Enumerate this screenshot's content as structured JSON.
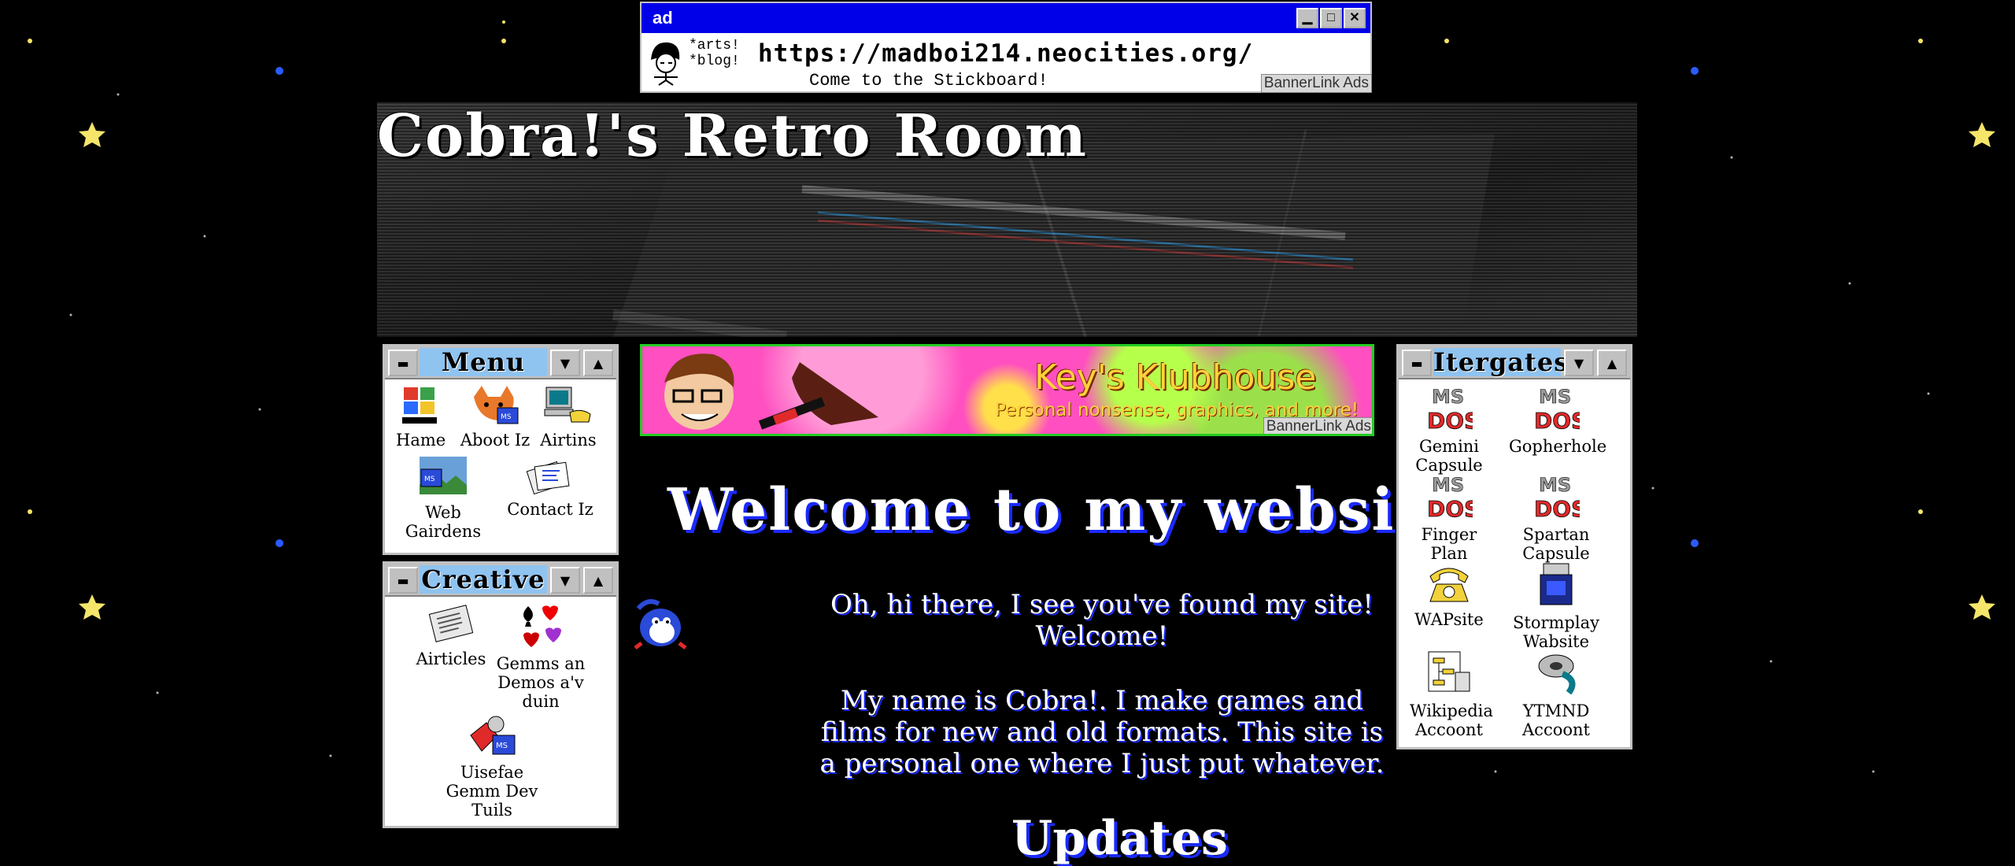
{
  "ad": {
    "title": "ad",
    "tagline": "*arts!\n*blog!",
    "url": "https://madboi214.neocities.org/",
    "subtext": "Come to the Stickboard!",
    "bannerlink": "BannerLink Ads"
  },
  "header": {
    "title": "Cobra!'s Retro Room"
  },
  "menu_panel": {
    "title": "Menu",
    "items": [
      {
        "label": "Hame",
        "icon": "windows-logo-icon"
      },
      {
        "label": "Aboot Iz",
        "icon": "fox-msdos-icon"
      },
      {
        "label": "Airtins",
        "icon": "computer-phone-icon"
      },
      {
        "label": "Web Gairdens",
        "icon": "msdos-landscape-icon"
      },
      {
        "label": "Contact Iz",
        "icon": "cards-icon"
      }
    ]
  },
  "creative_panel": {
    "title": "Creative",
    "items": [
      {
        "label": "Airticles",
        "icon": "newspaper-icon"
      },
      {
        "label": "Gemms an Demos a'v duin",
        "icon": "card-suits-icon"
      },
      {
        "label": "Uisefae Gemm Dev Tuils",
        "icon": "msdos-tools-icon"
      }
    ]
  },
  "klubhouse": {
    "title": "Key's Klubhouse",
    "subtitle": "Personal nonsense, graphics, and more!",
    "bannerlink": "BannerLink Ads"
  },
  "main": {
    "welcome": "Welcome to my website!",
    "intro_line1": "Oh, hi there, I see you've found my site!",
    "intro_line2": "Welcome!",
    "about_line1": "My name is Cobra!. I make games and",
    "about_line2": "films for new and old formats. This site is",
    "about_line3": "a personal one where I just put whatever.",
    "updates": "Updates"
  },
  "links_panel": {
    "title": "Itergates",
    "items": [
      {
        "label": "Gemini Capsule",
        "icon": "msdos-icon"
      },
      {
        "label": "Gopherhole",
        "icon": "msdos-icon"
      },
      {
        "label": "Finger Plan",
        "icon": "msdos-icon"
      },
      {
        "label": "Spartan Capsule",
        "icon": "msdos-icon"
      },
      {
        "label": "WAPsite",
        "icon": "telephone-icon"
      },
      {
        "label": "Stormplay Wabsite",
        "icon": "stormplay-icon"
      },
      {
        "label": "Wikipedia Accoont",
        "icon": "wikipedia-chart-icon"
      },
      {
        "label": "YTMND Accoont",
        "icon": "film-reel-icon"
      }
    ]
  },
  "colors": {
    "background": "#000000",
    "accent_blue": "#0000e8",
    "panel_title": "#8fc3f0",
    "text_shadow": "#1a2aff"
  }
}
